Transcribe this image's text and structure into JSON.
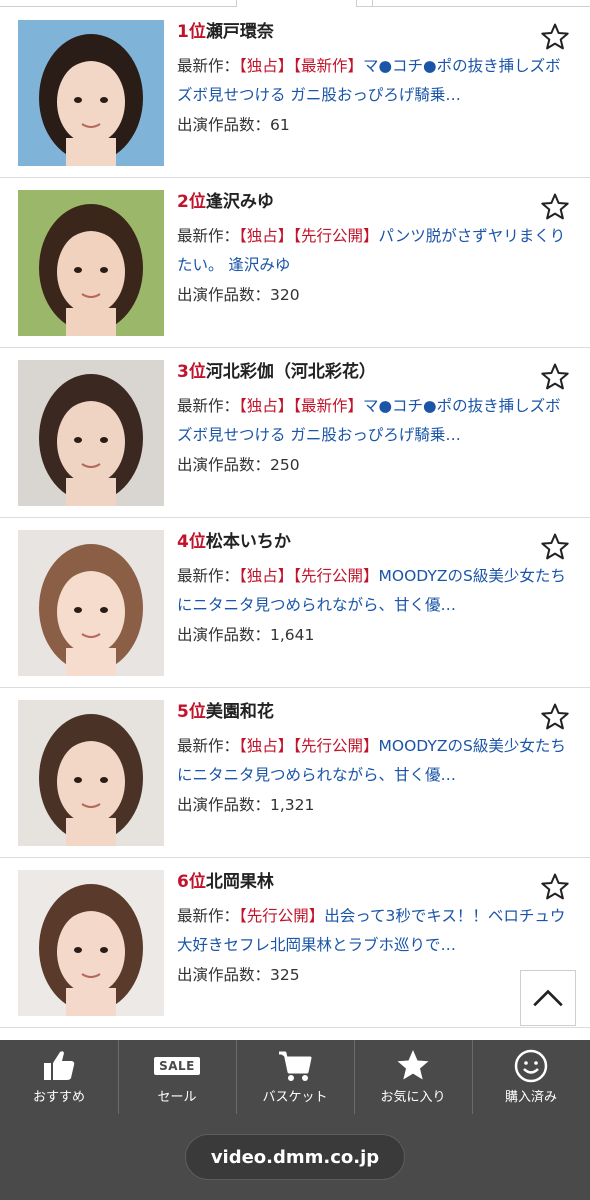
{
  "items": [
    {
      "rank": "1位",
      "name": "瀬戸環奈",
      "latest_label": "最新作：",
      "tags": "【独占】【最新作】",
      "work": "マ●コチ●ポの抜き挿しズボズボ見せつける ガニ股おっぴろげ騎乗…",
      "count_label": "出演作品数：",
      "count": "61",
      "colors": {
        "bg": "#7fb4d8",
        "hair": "#2a1c16",
        "skin": "#f3d7c6"
      }
    },
    {
      "rank": "2位",
      "name": "逢沢みゆ",
      "latest_label": "最新作：",
      "tags": "【独占】【先行公開】",
      "work": "パンツ脱がさずヤリまくりたい。 逢沢みゆ",
      "count_label": "出演作品数：",
      "count": "320",
      "colors": {
        "bg": "#9bb86a",
        "hair": "#3a261a",
        "skin": "#f0d2bf"
      }
    },
    {
      "rank": "3位",
      "name": "河北彩伽（河北彩花）",
      "latest_label": "最新作：",
      "tags": "【独占】【最新作】",
      "work": "マ●コチ●ポの抜き挿しズボズボ見せつける ガニ股おっぴろげ騎乗…",
      "count_label": "出演作品数：",
      "count": "250",
      "colors": {
        "bg": "#d9d6d2",
        "hair": "#3b2820",
        "skin": "#efd3c3"
      }
    },
    {
      "rank": "4位",
      "name": "松本いちか",
      "latest_label": "最新作：",
      "tags": "【独占】【先行公開】",
      "work": "MOODYZのS級美少女たちにニタニタ見つめられながら、甘く優…",
      "count_label": "出演作品数：",
      "count": "1,641",
      "colors": {
        "bg": "#e8e4e2",
        "hair": "#8a5f45",
        "skin": "#f5dccd"
      }
    },
    {
      "rank": "5位",
      "name": "美園和花",
      "latest_label": "最新作：",
      "tags": "【独占】【先行公開】",
      "work": "MOODYZのS級美少女たちにニタニタ見つめられながら、甘く優…",
      "count_label": "出演作品数：",
      "count": "1,321",
      "colors": {
        "bg": "#e6e3df",
        "hair": "#4a3226",
        "skin": "#f2d6c6"
      }
    },
    {
      "rank": "6位",
      "name": "北岡果林",
      "latest_label": "最新作：",
      "tags": "【先行公開】",
      "work": "出会って3秒でキス！！ベロチュウ大好きセフレ北岡果林とラブホ巡りで…",
      "count_label": "出演作品数：",
      "count": "325",
      "colors": {
        "bg": "#ece9e6",
        "hair": "#5a3a2b",
        "skin": "#f4d9ca"
      }
    }
  ],
  "scroll_top": {
    "icon": "chevron-up-icon"
  },
  "bottom_nav": [
    {
      "label": "おすすめ",
      "icon": "thumbs-up-icon"
    },
    {
      "label": "セール",
      "icon": "sale-icon",
      "badge": "SALE"
    },
    {
      "label": "バスケット",
      "icon": "cart-icon"
    },
    {
      "label": "お気に入り",
      "icon": "star-icon"
    },
    {
      "label": "購入済み",
      "icon": "smile-icon"
    }
  ],
  "url": "video.dmm.co.jp",
  "colors": {
    "rank": "#c0142b",
    "link": "#1a55a8",
    "bar": "#4a4a4a"
  }
}
